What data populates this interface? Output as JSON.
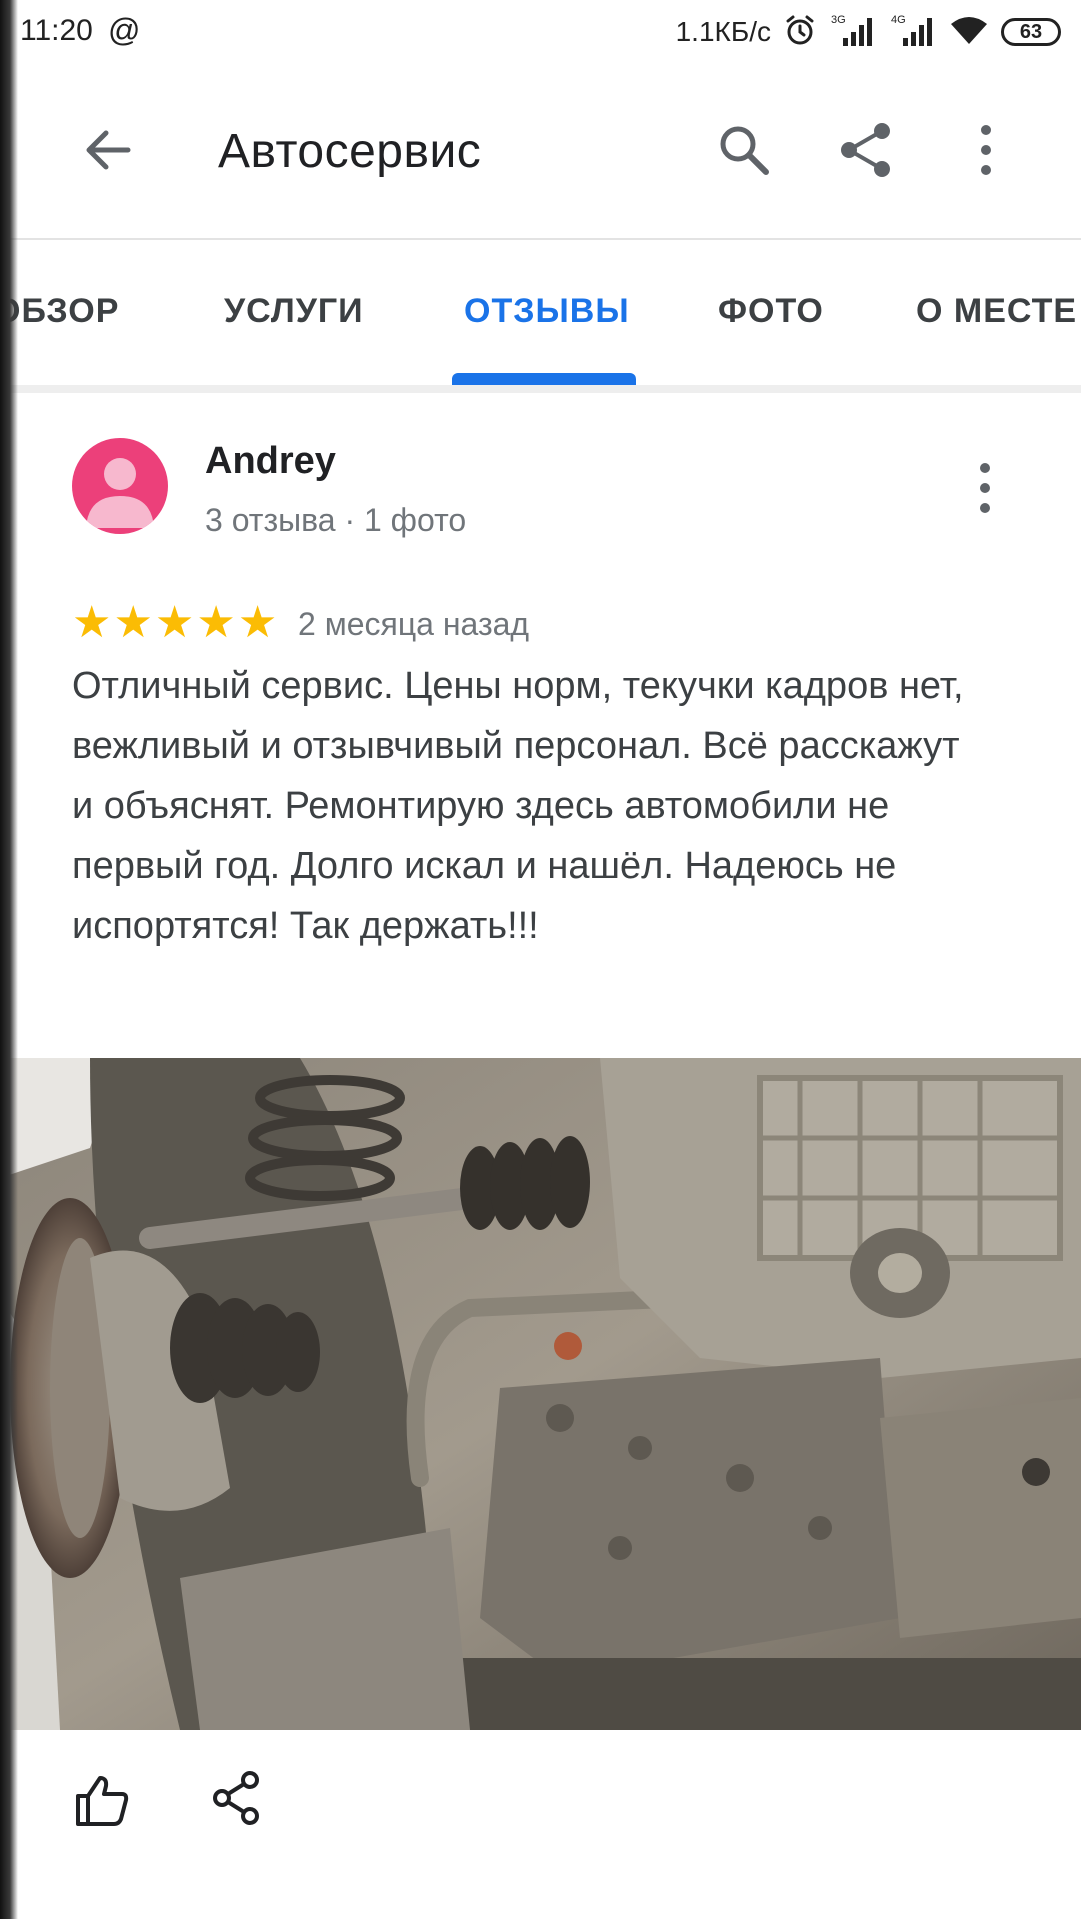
{
  "status_bar": {
    "time": "11:20",
    "at_symbol": "@",
    "speed": "1.1КБ/с",
    "network_3g": "3G",
    "network_4g": "4G",
    "battery": "63"
  },
  "app_bar": {
    "title": "Автосервис",
    "icons": [
      "back-arrow-icon",
      "search-icon",
      "share-icon",
      "more-vert-icon"
    ]
  },
  "tabs": [
    {
      "label": "ОБЗОР",
      "active": false
    },
    {
      "label": "УСЛУГИ",
      "active": false
    },
    {
      "label": "ОТЗЫВЫ",
      "active": true
    },
    {
      "label": "ФОТО",
      "active": false
    },
    {
      "label": "О МЕСТЕ",
      "active": false
    }
  ],
  "review": {
    "author": "Andrey",
    "meta": "3 отзыва · 1 фото",
    "rating": 5,
    "rating_max": 5,
    "date": "2 месяца назад",
    "text": "Отличный сервис. Цены норм, текучки кадров нет, вежливый и отзывчивый персонал. Всё расскажут и объяснят. Ремонтирую здесь автомобили не первый год. Долго искал и нашёл. Надеюсь не испортятся! Так держать!!!"
  },
  "colors": {
    "accent": "#1a73e8",
    "star": "#fbbc04",
    "avatar": "#ec407a"
  }
}
